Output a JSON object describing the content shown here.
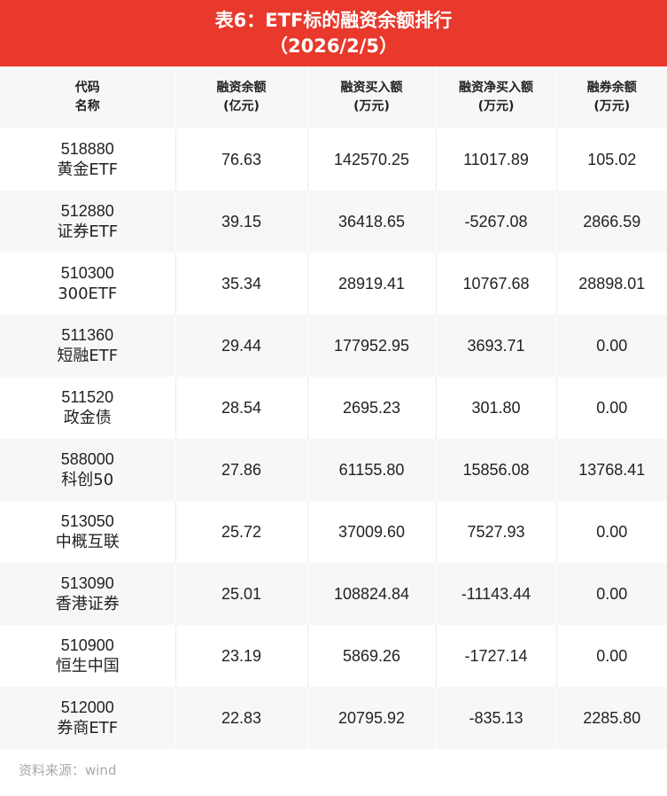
{
  "title": {
    "line1": "表6：ETF标的融资余额排行",
    "line2": "（2026/2/5）"
  },
  "columns": [
    {
      "line1": "代码",
      "line2": "名称"
    },
    {
      "line1": "融资余额",
      "line2": "(亿元)"
    },
    {
      "line1": "融资买入额",
      "line2": "(万元)"
    },
    {
      "line1": "融资净买入额",
      "line2": "(万元)"
    },
    {
      "line1": "融券余额",
      "line2": "(万元)"
    }
  ],
  "rows": [
    {
      "code": "518880",
      "name": "黄金ETF",
      "margin_balance": "76.63",
      "margin_buy": "142570.25",
      "net_buy": "11017.89",
      "short_balance": "105.02"
    },
    {
      "code": "512880",
      "name": "证券ETF",
      "margin_balance": "39.15",
      "margin_buy": "36418.65",
      "net_buy": "-5267.08",
      "short_balance": "2866.59"
    },
    {
      "code": "510300",
      "name": "300ETF",
      "margin_balance": "35.34",
      "margin_buy": "28919.41",
      "net_buy": "10767.68",
      "short_balance": "28898.01"
    },
    {
      "code": "511360",
      "name": "短融ETF",
      "margin_balance": "29.44",
      "margin_buy": "177952.95",
      "net_buy": "3693.71",
      "short_balance": "0.00"
    },
    {
      "code": "511520",
      "name": "政金债",
      "margin_balance": "28.54",
      "margin_buy": "2695.23",
      "net_buy": "301.80",
      "short_balance": "0.00"
    },
    {
      "code": "588000",
      "name": "科创50",
      "margin_balance": "27.86",
      "margin_buy": "61155.80",
      "net_buy": "15856.08",
      "short_balance": "13768.41"
    },
    {
      "code": "513050",
      "name": "中概互联",
      "margin_balance": "25.72",
      "margin_buy": "37009.60",
      "net_buy": "7527.93",
      "short_balance": "0.00"
    },
    {
      "code": "513090",
      "name": "香港证券",
      "margin_balance": "25.01",
      "margin_buy": "108824.84",
      "net_buy": "-11143.44",
      "short_balance": "0.00"
    },
    {
      "code": "510900",
      "name": "恒生中国",
      "margin_balance": "23.19",
      "margin_buy": "5869.26",
      "net_buy": "-1727.14",
      "short_balance": "0.00"
    },
    {
      "code": "512000",
      "name": "券商ETF",
      "margin_balance": "22.83",
      "margin_buy": "20795.92",
      "net_buy": "-835.13",
      "short_balance": "2285.80"
    }
  ],
  "source": "资料来源：wind",
  "colors": {
    "header_red": "#e8392c",
    "row_alt": "#f7f7f7",
    "source_text": "#a9a9a9"
  }
}
